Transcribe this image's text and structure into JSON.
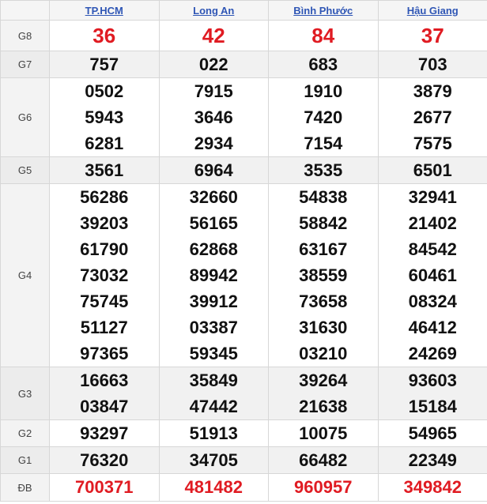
{
  "provinces": [
    "TP.HCM",
    "Long An",
    "Bình Phước",
    "Hậu Giang"
  ],
  "prizes": [
    {
      "label": "G8",
      "values": [
        [
          "36"
        ],
        [
          "42"
        ],
        [
          "84"
        ],
        [
          "37"
        ]
      ]
    },
    {
      "label": "G7",
      "values": [
        [
          "757"
        ],
        [
          "022"
        ],
        [
          "683"
        ],
        [
          "703"
        ]
      ]
    },
    {
      "label": "G6",
      "values": [
        [
          "0502",
          "5943",
          "6281"
        ],
        [
          "7915",
          "3646",
          "2934"
        ],
        [
          "1910",
          "7420",
          "7154"
        ],
        [
          "3879",
          "2677",
          "7575"
        ]
      ]
    },
    {
      "label": "G5",
      "values": [
        [
          "3561"
        ],
        [
          "6964"
        ],
        [
          "3535"
        ],
        [
          "6501"
        ]
      ]
    },
    {
      "label": "G4",
      "values": [
        [
          "56286",
          "39203",
          "61790",
          "73032",
          "75745",
          "51127",
          "97365"
        ],
        [
          "32660",
          "56165",
          "62868",
          "89942",
          "39912",
          "03387",
          "59345"
        ],
        [
          "54838",
          "58842",
          "63167",
          "38559",
          "73658",
          "31630",
          "03210"
        ],
        [
          "32941",
          "21402",
          "84542",
          "60461",
          "08324",
          "46412",
          "24269"
        ]
      ]
    },
    {
      "label": "G3",
      "values": [
        [
          "16663",
          "03847"
        ],
        [
          "35849",
          "47442"
        ],
        [
          "39264",
          "21638"
        ],
        [
          "93603",
          "15184"
        ]
      ]
    },
    {
      "label": "G2",
      "values": [
        [
          "93297"
        ],
        [
          "51913"
        ],
        [
          "10075"
        ],
        [
          "54965"
        ]
      ]
    },
    {
      "label": "G1",
      "values": [
        [
          "76320"
        ],
        [
          "34705"
        ],
        [
          "66482"
        ],
        [
          "22349"
        ]
      ]
    },
    {
      "label": "ĐB",
      "values": [
        [
          "700371"
        ],
        [
          "481482"
        ],
        [
          "960957"
        ],
        [
          "349842"
        ]
      ]
    }
  ],
  "colors": {
    "accent_red": "#e01b22",
    "link_blue": "#2f56b5"
  }
}
